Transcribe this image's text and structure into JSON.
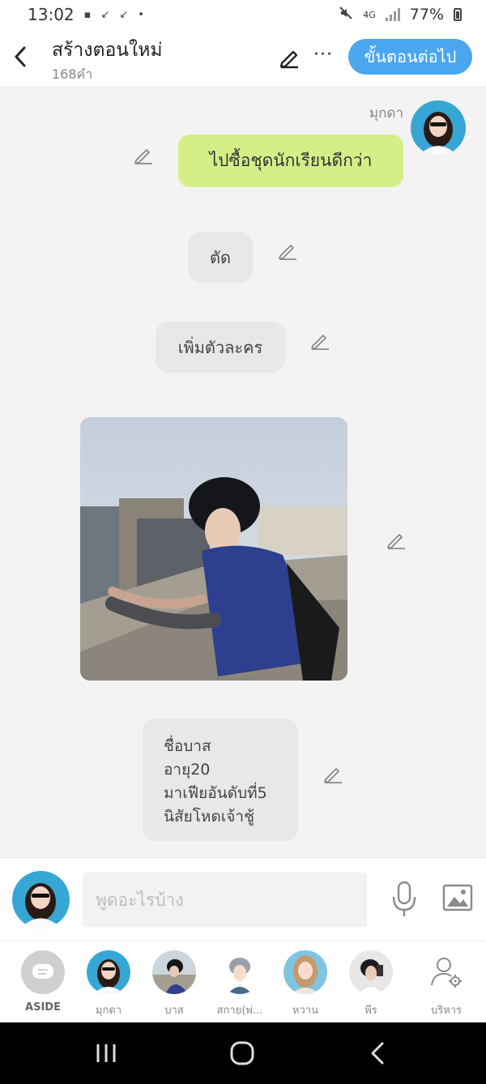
{
  "status_bar": {
    "time": "13:02",
    "network": "4G",
    "battery": "77%"
  },
  "header": {
    "title": "สร้างตอนใหม่",
    "word_count": "168คำ",
    "next_label": "ขั้นตอนต่อไป",
    "accent_color": "#4aa6ef"
  },
  "chat": {
    "speaker_name": "มุกดา",
    "messages": [
      {
        "type": "speech",
        "text": "ไปซื้อชุดนักเรียนดีกว่า",
        "bubble_color": "#d5ef87"
      },
      {
        "type": "narration",
        "text": "ตัด"
      },
      {
        "type": "narration",
        "text": "เพิ่มตัวละคร"
      },
      {
        "type": "image",
        "description_icon": "photo"
      },
      {
        "type": "narration",
        "text": "ชื่อบาส\nอายุ20\nมาเฟียอันดับที่5\nนิสัยโหดเจ้าชู้"
      }
    ]
  },
  "composer": {
    "placeholder": "พูดอะไรบ้าง",
    "icons": [
      "microphone-icon",
      "image-icon"
    ]
  },
  "characters": [
    {
      "label": "ASIDE"
    },
    {
      "label": "มุกดา"
    },
    {
      "label": "บาส"
    },
    {
      "label": "สกาย(พ่..."
    },
    {
      "label": "หวาน"
    },
    {
      "label": "พีร"
    },
    {
      "label": "บริหาร"
    }
  ],
  "nav_bar": {
    "icons": [
      "recent-apps-icon",
      "home-icon",
      "back-icon"
    ]
  }
}
